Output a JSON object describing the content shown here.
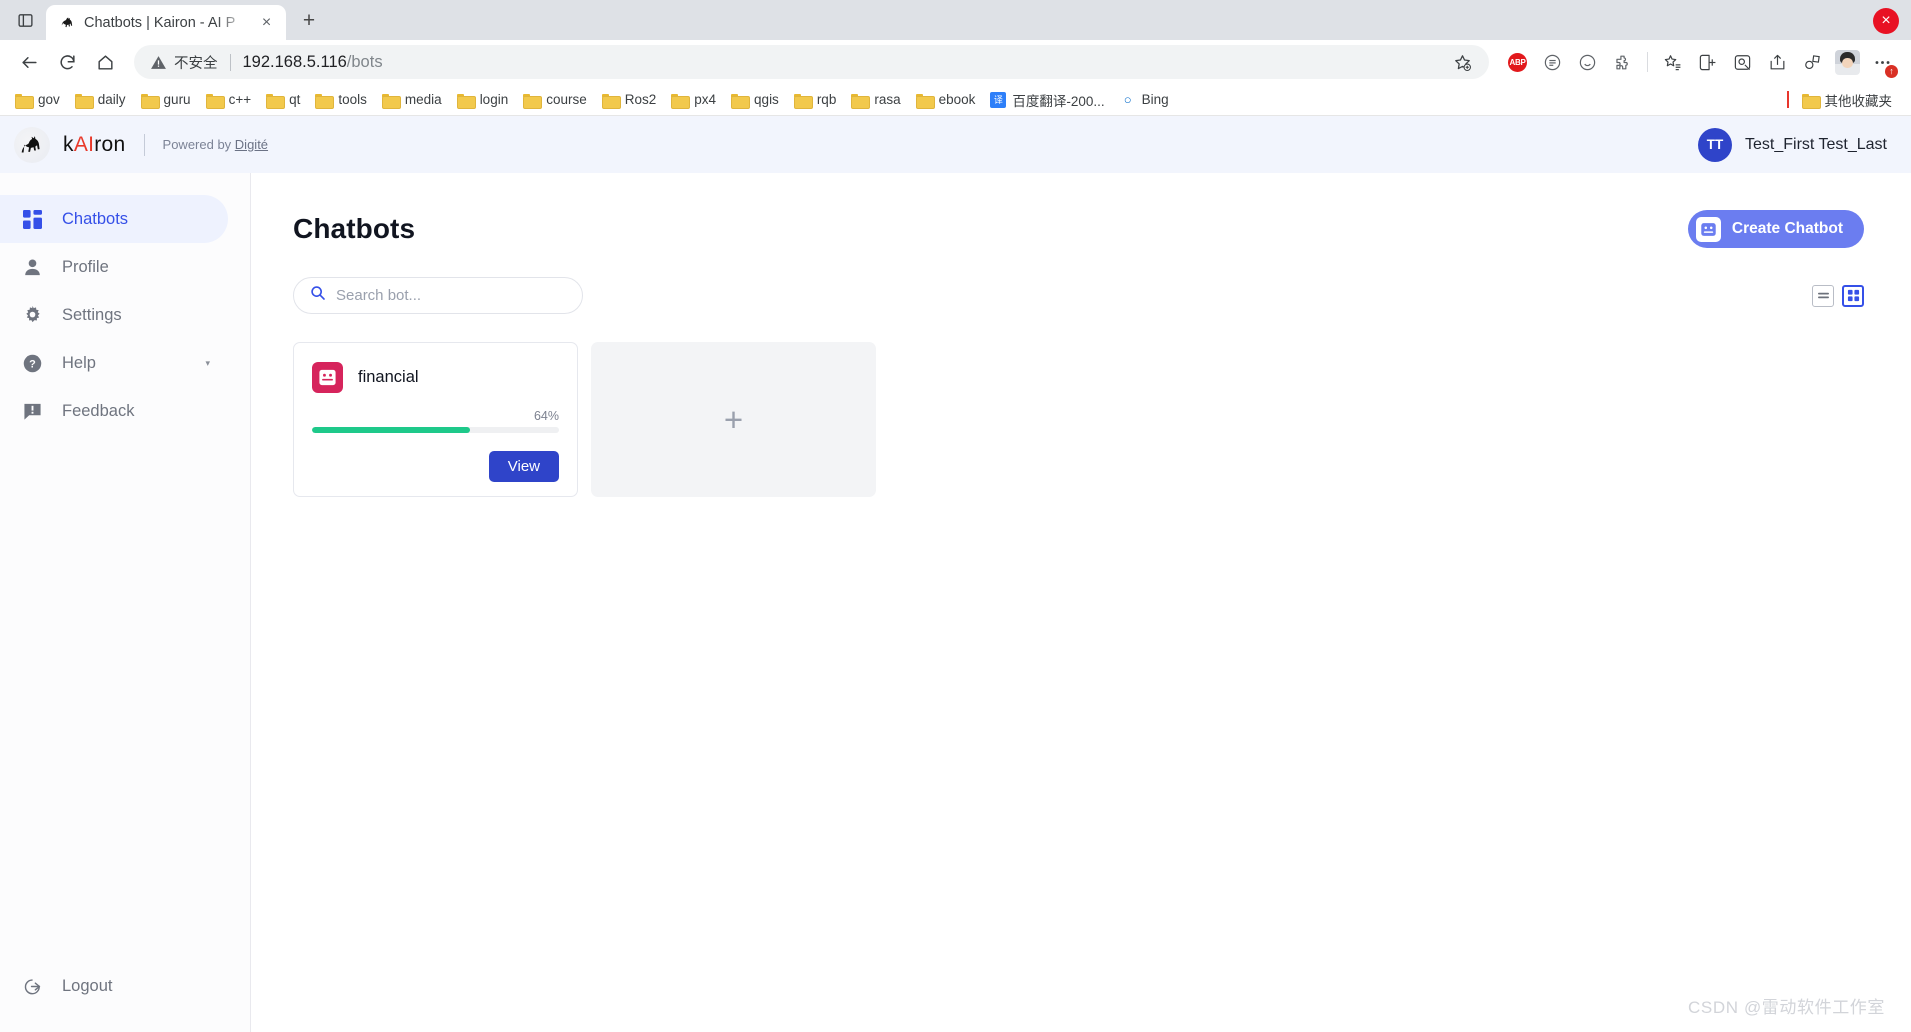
{
  "browser": {
    "tab": {
      "title": "Chatbots | Kairon - AI P",
      "favicon": "horse-icon",
      "close": "×"
    },
    "newtab_label": "+",
    "window_close": "×",
    "omnibox": {
      "security_text": "不安全",
      "host": "192.168.5.116",
      "path": "/bots"
    },
    "nav": {
      "back": "back-icon",
      "reload": "reload-icon",
      "home": "home-icon"
    },
    "extensions": [
      {
        "name": "adblock-plus-icon",
        "label": "ABP"
      },
      {
        "name": "reading-list-icon",
        "label": ""
      },
      {
        "name": "emoji-icon",
        "label": ""
      },
      {
        "name": "puzzle-icon",
        "label": ""
      },
      {
        "name": "collections-icon",
        "label": ""
      },
      {
        "name": "split-screen-icon",
        "label": ""
      },
      {
        "name": "screenshot-icon",
        "label": ""
      },
      {
        "name": "share-icon",
        "label": ""
      },
      {
        "name": "copilot-icon",
        "label": ""
      }
    ],
    "menu_badge": "↑",
    "bookmarks": [
      {
        "label": "gov",
        "icon": "folder-icon"
      },
      {
        "label": "daily",
        "icon": "folder-icon"
      },
      {
        "label": "guru",
        "icon": "folder-icon"
      },
      {
        "label": "c++",
        "icon": "folder-icon"
      },
      {
        "label": "qt",
        "icon": "folder-icon"
      },
      {
        "label": "tools",
        "icon": "folder-icon"
      },
      {
        "label": "media",
        "icon": "folder-icon"
      },
      {
        "label": "login",
        "icon": "folder-icon"
      },
      {
        "label": "course",
        "icon": "folder-icon"
      },
      {
        "label": "Ros2",
        "icon": "folder-icon"
      },
      {
        "label": "px4",
        "icon": "folder-icon"
      },
      {
        "label": "qgis",
        "icon": "folder-icon"
      },
      {
        "label": "rqb",
        "icon": "folder-icon"
      },
      {
        "label": "rasa",
        "icon": "folder-icon"
      },
      {
        "label": "ebook",
        "icon": "folder-icon"
      },
      {
        "label": "百度翻译-200...",
        "icon": "translate-icon"
      },
      {
        "label": "Bing",
        "icon": "bing-icon"
      }
    ],
    "other_bookmarks": {
      "label": "其他收藏夹",
      "icon": "folder-icon"
    }
  },
  "app_header": {
    "logo_prefix": "k",
    "logo_accent": "AI",
    "logo_suffix": "ron",
    "powered_prefix": "Powered by ",
    "powered_brand": "Digité",
    "user": {
      "initials": "TT",
      "name": "Test_First Test_Last"
    }
  },
  "sidebar": {
    "items": [
      {
        "label": "Chatbots",
        "icon": "dashboard-icon",
        "active": true
      },
      {
        "label": "Profile",
        "icon": "person-icon",
        "active": false
      },
      {
        "label": "Settings",
        "icon": "gear-icon",
        "active": false
      },
      {
        "label": "Help",
        "icon": "help-circle-icon",
        "active": false,
        "chevron": "▾"
      },
      {
        "label": "Feedback",
        "icon": "feedback-icon",
        "active": false
      }
    ],
    "logout": {
      "label": "Logout",
      "icon": "logout-icon"
    }
  },
  "main": {
    "title": "Chatbots",
    "create_button": {
      "label": "Create Chatbot",
      "icon": "robot-icon",
      "color": "#6b7df0"
    },
    "search": {
      "placeholder": "Search bot...",
      "value": "",
      "icon": "search-icon"
    },
    "view_toggle": {
      "list": {
        "name": "list-view-icon",
        "active": false
      },
      "grid": {
        "name": "grid-view-icon",
        "active": true
      }
    },
    "bots": [
      {
        "name": "financial",
        "icon": "robot-icon",
        "icon_color": "#d6245c",
        "progress_label": "64%",
        "progress_value": 64,
        "progress_color": "#1ec98a",
        "action_label": "View"
      }
    ],
    "add_card": {
      "label": "+"
    },
    "watermark": "CSDN @雷动软件工作室"
  }
}
